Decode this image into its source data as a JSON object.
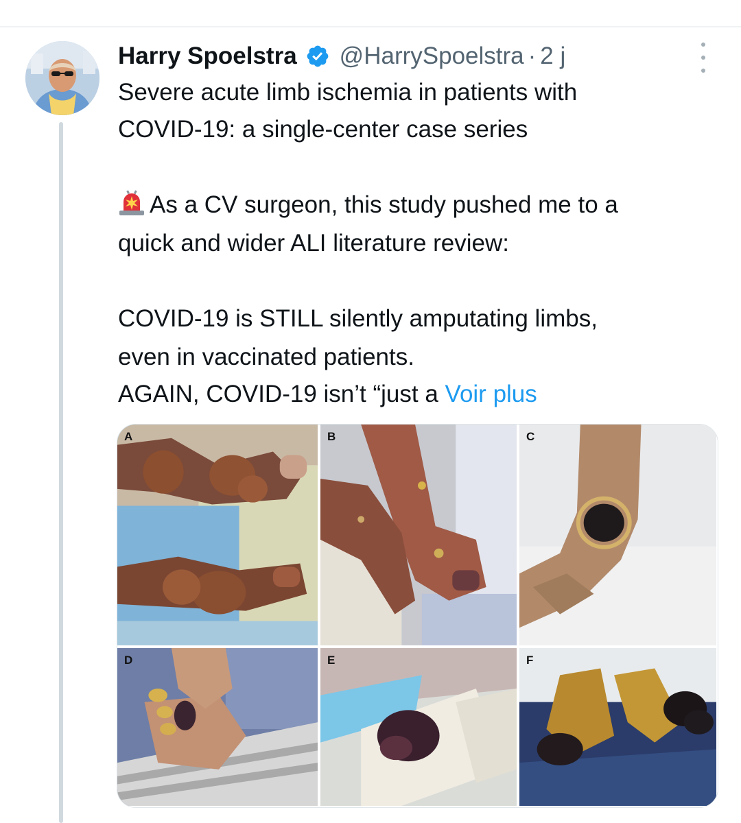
{
  "tweet": {
    "author_name": "Harry Spoelstra",
    "handle": "@HarrySpoelstra",
    "separator": "·",
    "time": "2 j",
    "lines": [
      "Severe acute limb ischemia in patients with",
      "COVID-19: a single-center case series",
      "As a CV surgeon, this study pushed me to a",
      "quick and wider ALI literature review:",
      "COVID-19 is STILL silently amputating limbs,",
      "even in vaccinated patients.",
      "AGAIN, COVID-19 isn’t “just a "
    ],
    "more_link": "Voir plus"
  },
  "media": {
    "panels": [
      {
        "label": "A"
      },
      {
        "label": "B"
      },
      {
        "label": "C"
      },
      {
        "label": "D"
      },
      {
        "label": "E"
      },
      {
        "label": "F"
      }
    ]
  },
  "icons": {
    "verified": "verified-badge-icon",
    "siren": "police-light-icon",
    "more": "more-options-icon"
  },
  "colors": {
    "text": "#0f1419",
    "secondary": "#536471",
    "link": "#1d9bf0",
    "thread_line": "#cfd9de"
  }
}
